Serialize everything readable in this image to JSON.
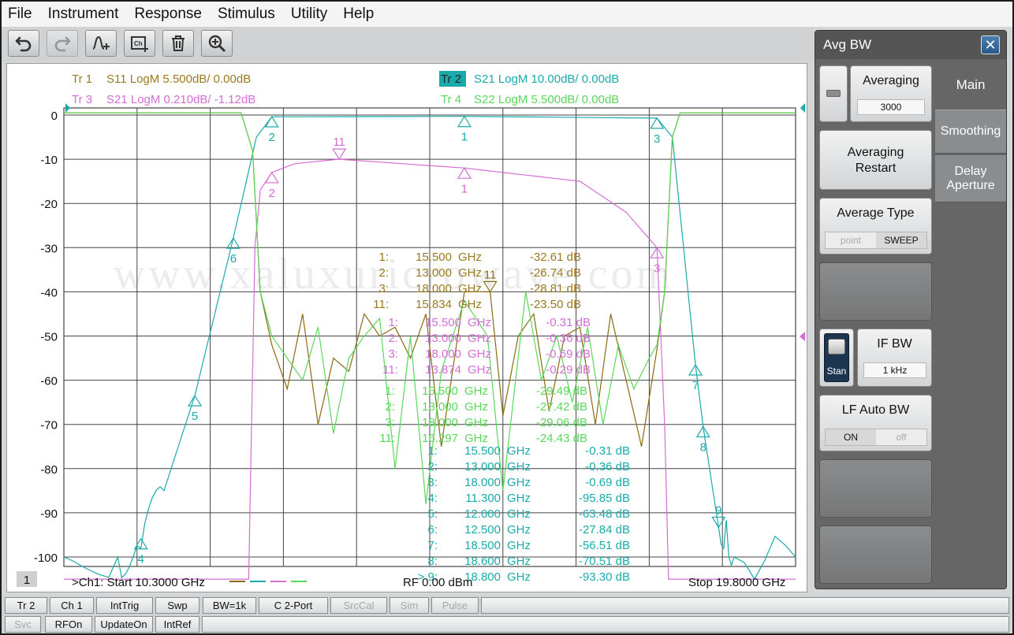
{
  "menu": [
    "File",
    "Instrument",
    "Response",
    "Stimulus",
    "Utility",
    "Help"
  ],
  "toolbar": {
    "buttons": [
      {
        "name": "undo-button",
        "icon": "undo-icon"
      },
      {
        "name": "redo-button",
        "icon": "redo-icon"
      },
      {
        "name": "add-marker-button",
        "icon": "marker-add-icon"
      },
      {
        "name": "add-channel-button",
        "icon": "channel-add-icon"
      },
      {
        "name": "delete-button",
        "icon": "trash-icon"
      },
      {
        "name": "zoom-button",
        "icon": "zoom-in-icon"
      }
    ]
  },
  "traces": [
    {
      "label": "Tr 1",
      "desc": "S11 LogM 5.500dB/  0.00dB",
      "color": "#9a7a1e"
    },
    {
      "label": "Tr 2",
      "desc": "S21 LogM 10.00dB/  0.00dB",
      "color": "#1aaaaa",
      "active": true
    },
    {
      "label": "Tr 3",
      "desc": "S21 LogM 0.210dB/  -1.12dB",
      "color": "#d46ed4"
    },
    {
      "label": "Tr 4",
      "desc": "S22 LogM 5.500dB/  0.00dB",
      "color": "#5ad85a"
    }
  ],
  "y_ticks": [
    "0",
    "-10",
    "-20",
    "-30",
    "-40",
    "-50",
    "-60",
    "-70",
    "-80",
    "-90",
    "-100"
  ],
  "watermark": "www.xaluxuricrowave.com",
  "marker_tables": {
    "tr1": [
      {
        "n": "1:",
        "f": "15.500",
        "u": "GHz",
        "v": "-32.61 dB"
      },
      {
        "n": "2:",
        "f": "13.000",
        "u": "GHz",
        "v": "-26.74 dB"
      },
      {
        "n": "3:",
        "f": "18.000",
        "u": "GHz",
        "v": "-28.81 dB"
      },
      {
        "n": "11:",
        "f": "15.834",
        "u": "GHz",
        "v": "-23.50 dB"
      }
    ],
    "tr3": [
      {
        "n": "1:",
        "f": "15.500",
        "u": "GHz",
        "v": "-0.31 dB"
      },
      {
        "n": "2:",
        "f": "13.000",
        "u": "GHz",
        "v": "-0.36 dB"
      },
      {
        "n": "3:",
        "f": "18.000",
        "u": "GHz",
        "v": "-0.69 dB"
      },
      {
        "n": "11:",
        "f": "13.874",
        "u": "GHz",
        "v": "-0.29 dB"
      }
    ],
    "tr4": [
      {
        "n": "1:",
        "f": "15.500",
        "u": "GHz",
        "v": "-29.49 dB"
      },
      {
        "n": "2:",
        "f": "13.000",
        "u": "GHz",
        "v": "-27.42 dB"
      },
      {
        "n": "3:",
        "f": "18.000",
        "u": "GHz",
        "v": "-29.06 dB"
      },
      {
        "n": "11:",
        "f": "16.297",
        "u": "GHz",
        "v": "-24.43 dB"
      }
    ],
    "tr2": [
      {
        "n": "1:",
        "f": "15.500",
        "u": "GHz",
        "v": "-0.31 dB"
      },
      {
        "n": "2:",
        "f": "13.000",
        "u": "GHz",
        "v": "-0.36 dB"
      },
      {
        "n": "3:",
        "f": "18.000",
        "u": "GHz",
        "v": "-0.69 dB"
      },
      {
        "n": "4:",
        "f": "11.300",
        "u": "GHz",
        "v": "-95.85 dB"
      },
      {
        "n": "5:",
        "f": "12.000",
        "u": "GHz",
        "v": "-63.48 dB"
      },
      {
        "n": "6:",
        "f": "12.500",
        "u": "GHz",
        "v": "-27.84 dB"
      },
      {
        "n": "7:",
        "f": "18.500",
        "u": "GHz",
        "v": "-56.51 dB"
      },
      {
        "n": "8:",
        "f": "18.600",
        "u": "GHz",
        "v": "-70.51 dB"
      },
      {
        "n": "> 9:",
        "f": "18.800",
        "u": "GHz",
        "v": "-93.30 dB"
      }
    ]
  },
  "chart_footer": {
    "channel_num": "1",
    "start_label": ">Ch1:  Start  10.3000 GHz",
    "rf_label": "RF    0.00 dBm",
    "stop_label": "Stop  19.8000 GHz"
  },
  "chart_data": {
    "type": "line",
    "x_range_ghz": [
      10.3,
      19.8
    ],
    "ylim": [
      -105,
      3
    ],
    "y_ticks": [
      0,
      -10,
      -20,
      -30,
      -40,
      -50,
      -60,
      -70,
      -80,
      -90,
      -100
    ],
    "series": [
      {
        "name": "Tr 2 S21",
        "color": "#1aaaaa",
        "x": [
          10.3,
          11.0,
          11.3,
          11.6,
          12.0,
          12.5,
          12.8,
          13.0,
          15.5,
          18.0,
          18.2,
          18.5,
          18.6,
          18.8,
          19.0,
          19.8
        ],
        "y": [
          -100,
          -100,
          -98,
          -85,
          -63.5,
          -27.8,
          -5,
          -0.4,
          -0.3,
          -0.7,
          -5,
          -56.5,
          -70.5,
          -93.3,
          -100,
          -100
        ]
      },
      {
        "name": "Tr 3 S21",
        "color": "#d46ed4",
        "x": [
          10.3,
          12.7,
          12.78,
          12.85,
          13.0,
          13.3,
          13.874,
          15.5,
          17.0,
          17.6,
          18.0,
          18.1,
          18.15,
          19.8
        ],
        "y": [
          -105,
          -105,
          -30,
          -17,
          -13,
          -11,
          -10,
          -12,
          -15,
          -22,
          -30,
          -70,
          -105,
          -105
        ]
      },
      {
        "name": "Tr 1 S11",
        "color": "#8a6a10",
        "x": [
          10.3,
          12.6,
          12.75,
          12.85,
          13.0,
          13.2,
          13.4,
          13.6,
          13.8,
          14.0,
          14.2,
          14.4,
          14.6,
          14.8,
          15.0,
          15.2,
          15.5,
          15.834,
          16.0,
          16.2,
          16.4,
          16.6,
          16.8,
          17.0,
          17.2,
          17.4,
          17.6,
          17.8,
          18.0,
          18.1,
          18.2,
          18.3,
          19.8
        ],
        "y": [
          0.5,
          0.5,
          -8,
          -40,
          -52,
          -62,
          -45,
          -70,
          -55,
          -58,
          -45,
          -50,
          -48,
          -55,
          -45,
          -75,
          -40,
          -40,
          -68,
          -50,
          -45,
          -67,
          -50,
          -48,
          -70,
          -45,
          -60,
          -75,
          -53,
          -40,
          -5,
          0.5,
          0.5
        ]
      },
      {
        "name": "Tr 4 S22",
        "color": "#5ad85a",
        "x": [
          10.3,
          12.6,
          12.75,
          12.85,
          13.0,
          13.2,
          13.4,
          13.6,
          13.8,
          14.0,
          14.2,
          14.4,
          14.6,
          14.8,
          15.0,
          15.2,
          15.5,
          15.8,
          16.0,
          16.297,
          16.5,
          16.7,
          16.9,
          17.1,
          17.3,
          17.5,
          17.7,
          17.9,
          18.0,
          18.1,
          18.2,
          18.3,
          19.8
        ],
        "y": [
          0.5,
          0.5,
          -8,
          -40,
          -50,
          -55,
          -60,
          -48,
          -72,
          -55,
          -50,
          -46,
          -80,
          -50,
          -88,
          -58,
          -42,
          -50,
          -85,
          -40,
          -60,
          -50,
          -65,
          -48,
          -70,
          -52,
          -62,
          -55,
          -52,
          -40,
          -5,
          0.5,
          0.5
        ]
      }
    ]
  },
  "panel": {
    "title": "Avg BW",
    "close_label": "✕",
    "tabs": [
      "Main",
      "Smoothing",
      "Delay\nAperture"
    ],
    "averaging_label": "Averaging",
    "averaging_value": "3000",
    "restart_label": "Averaging\nRestart",
    "avg_type_label": "Average Type",
    "avg_type_opts": [
      "point",
      "SWEEP"
    ],
    "stan_label": "Stan",
    "ifbw_label": "IF BW",
    "ifbw_value": "1 kHz",
    "lf_auto_label": "LF Auto BW",
    "lf_opts": [
      "ON",
      "off"
    ]
  },
  "status_row1": [
    {
      "label": "Tr 2",
      "dim": false
    },
    {
      "label": "Ch 1",
      "dim": false
    },
    {
      "label": "IntTrig",
      "dim": false
    },
    {
      "label": "Swp",
      "dim": false
    },
    {
      "label": "BW=1k",
      "dim": false
    },
    {
      "label": "C  2-Port",
      "dim": false
    },
    {
      "label": "SrcCal",
      "dim": true
    },
    {
      "label": "Sim",
      "dim": true
    },
    {
      "label": "Pulse",
      "dim": true
    }
  ],
  "status_row2": [
    {
      "label": "Svc",
      "dim": true
    },
    {
      "label": "RFOn",
      "dim": false
    },
    {
      "label": "UpdateOn",
      "dim": false
    },
    {
      "label": "IntRef",
      "dim": false
    }
  ]
}
